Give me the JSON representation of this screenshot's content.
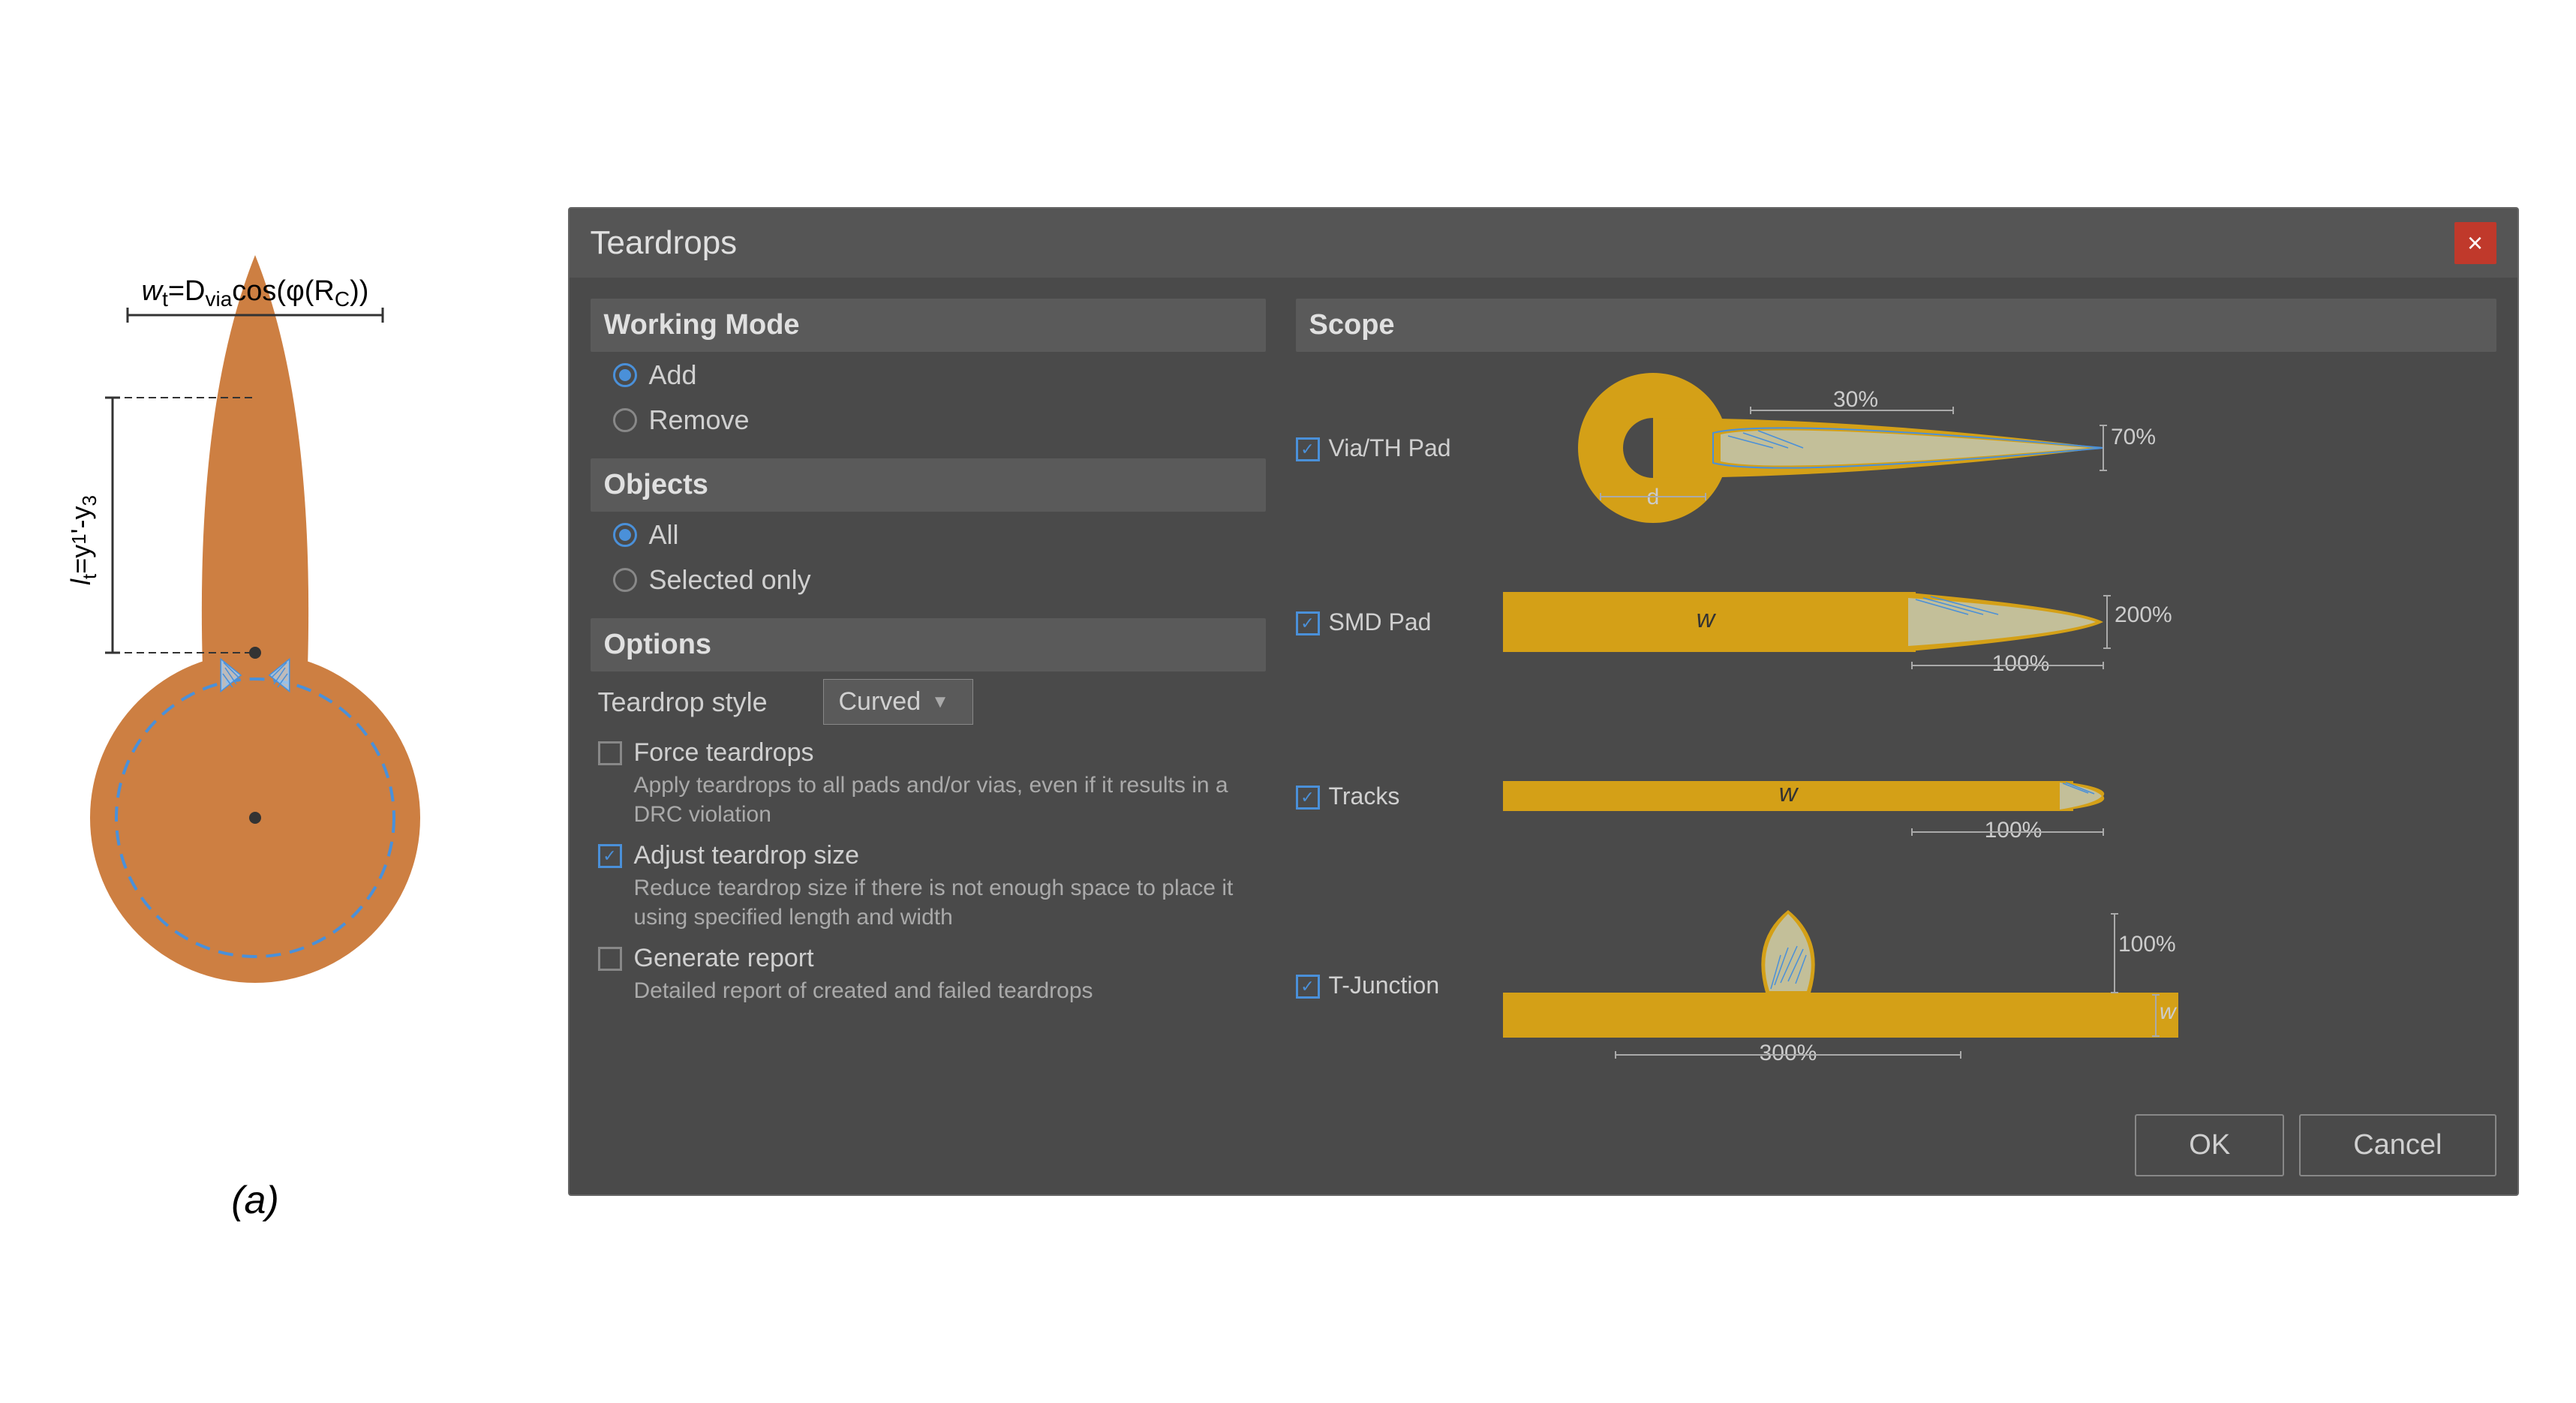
{
  "left": {
    "label": "(a)"
  },
  "dialog": {
    "title": "Teardrops",
    "close_btn": "×",
    "working_mode": {
      "header": "Working Mode",
      "options": [
        {
          "label": "Add",
          "selected": true
        },
        {
          "label": "Remove",
          "selected": false
        }
      ]
    },
    "objects": {
      "header": "Objects",
      "options": [
        {
          "label": "All",
          "selected": true
        },
        {
          "label": "Selected only",
          "selected": false
        }
      ]
    },
    "options_section": {
      "header": "Options",
      "teardrop_style_label": "Teardrop style",
      "teardrop_style_value": "Curved",
      "checkboxes": [
        {
          "checked": false,
          "label": "Force teardrops",
          "desc": "Apply teardrops to all pads and/or vias, even if it results in a DRC violation"
        },
        {
          "checked": true,
          "label": "Adjust teardrop size",
          "desc": "Reduce teardrop size if there is not enough space to place it using specified length and width"
        },
        {
          "checked": false,
          "label": "Generate report",
          "desc": "Detailed report of created and failed teardrops"
        }
      ]
    },
    "scope": {
      "header": "Scope",
      "items": [
        {
          "label": "Via/TH Pad",
          "checked": true,
          "pct1": "30%",
          "pct2": "70%",
          "pct3": "d"
        },
        {
          "label": "SMD Pad",
          "checked": true,
          "pct1": "200%",
          "pct2": "100%",
          "pct3": "w"
        },
        {
          "label": "Tracks",
          "checked": true,
          "pct1": "100%",
          "pct2": "w"
        },
        {
          "label": "T-Junction",
          "checked": true,
          "pct1": "100%",
          "pct2": "300%",
          "pct3": "w"
        }
      ]
    },
    "footer": {
      "ok": "OK",
      "cancel": "Cancel"
    }
  }
}
